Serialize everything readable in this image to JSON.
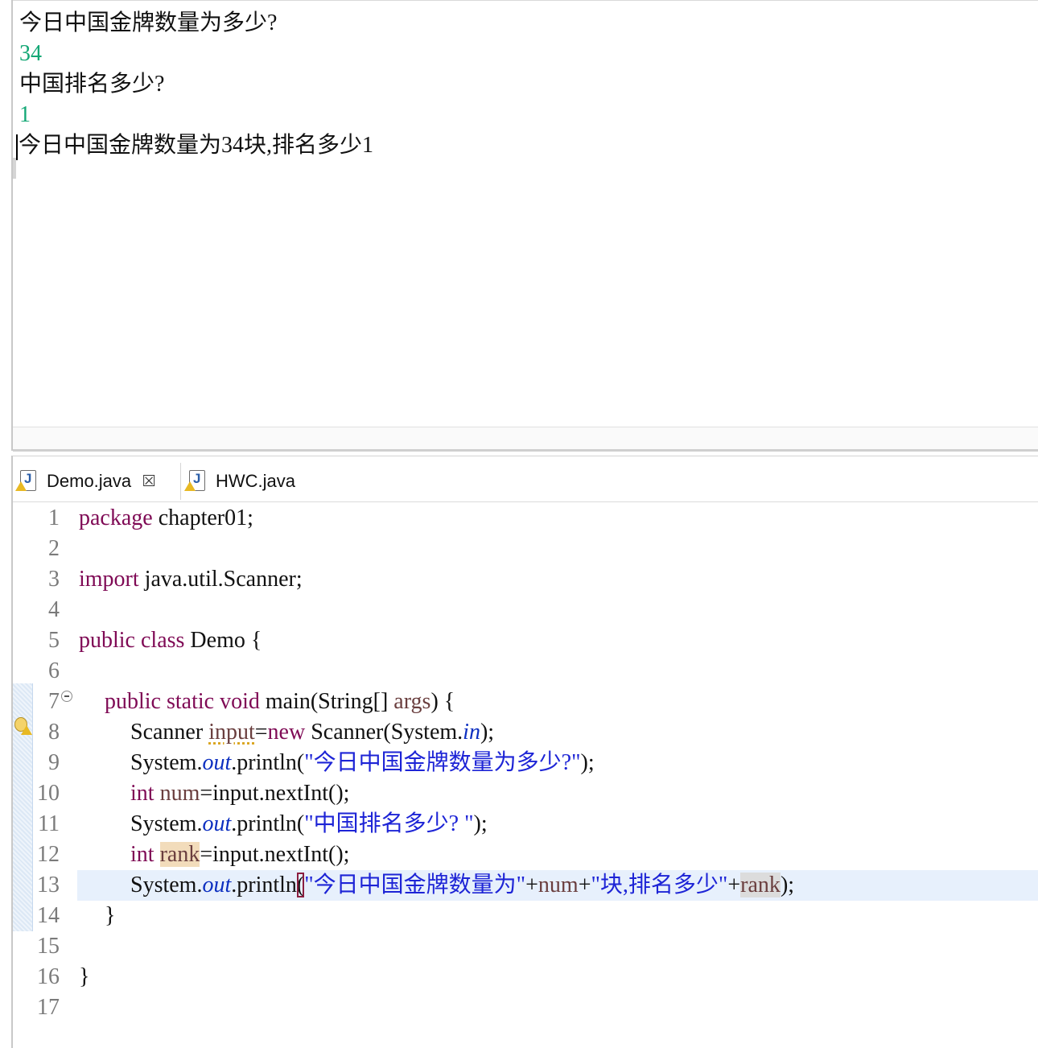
{
  "console": {
    "lines": [
      {
        "text": "今日中国金牌数量为多少?",
        "kind": "output"
      },
      {
        "text": "34",
        "kind": "input"
      },
      {
        "text": "中国排名多少?",
        "kind": "output"
      },
      {
        "text": "1",
        "kind": "input"
      },
      {
        "text": "今日中国金牌数量为34块,排名多少1",
        "kind": "output"
      }
    ]
  },
  "editor": {
    "tabs": [
      {
        "label": "Demo.java",
        "active": true,
        "closable": true,
        "icon": "java-file-warning-icon"
      },
      {
        "label": "HWC.java",
        "active": false,
        "closable": false,
        "icon": "java-file-warning-icon"
      }
    ],
    "close_glyph": "⮽",
    "line_numbers": [
      "1",
      "2",
      "3",
      "4",
      "5",
      "6",
      "7",
      "8",
      "9",
      "10",
      "11",
      "12",
      "13",
      "14",
      "15",
      "16",
      "17"
    ],
    "code": {
      "l1_kw": "package",
      "l1_rest": " chapter01;",
      "l3_kw": "import",
      "l3_rest": " java.util.Scanner;",
      "l5_kw": "public class",
      "l5_rest": " Demo {",
      "l7_kw": "public static void",
      "l7_a": " main(String[] ",
      "l7_var": "args",
      "l7_b": ") {",
      "l8_a": "Scanner ",
      "l8_var": "input",
      "l8_b": "=",
      "l8_kw": "new",
      "l8_c": " Scanner(System.",
      "l8_fld": "in",
      "l8_d": ");",
      "l9_a": "System.",
      "l9_fld": "out",
      "l9_b": ".println(",
      "l9_str": "\"今日中国金牌数量为多少?\"",
      "l9_c": ");",
      "l10_kw": "int",
      "l10_var": " num",
      "l10_a": "=input.nextInt();",
      "l11_a": "System.",
      "l11_fld": "out",
      "l11_b": ".println(",
      "l11_str": "\"中国排名多少? \"",
      "l11_c": ");",
      "l12_kw": "int",
      "l12_sp": " ",
      "l12_var": "rank",
      "l12_a": "=input.nextInt();",
      "l13_a": "System.",
      "l13_fld": "out",
      "l13_b": ".println",
      "l13_paren": "(",
      "l13_str1": "\"今日中国金牌数量为\"",
      "l13_p1": "+",
      "l13_var1": "num",
      "l13_p2": "+",
      "l13_str2": "\"块,排名多少\"",
      "l13_p3": "+",
      "l13_var2": "rank",
      "l13_c": ");",
      "l14": "}",
      "l16": "}"
    }
  },
  "colors": {
    "keyword": "#7f0a55",
    "string": "#1d24d6",
    "field": "#0c2fc0",
    "console_input": "#13a775",
    "current_line": "#e7f0fc"
  }
}
